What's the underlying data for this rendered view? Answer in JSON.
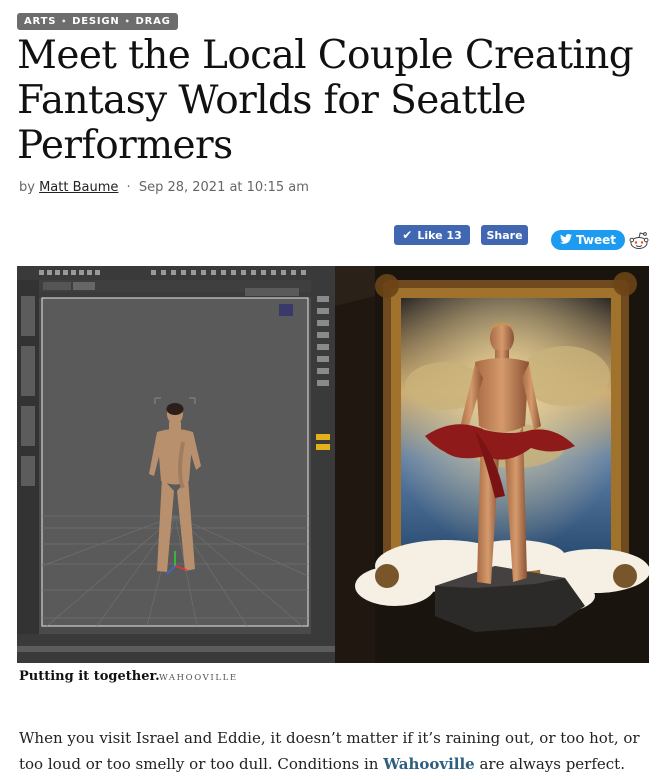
{
  "article": {
    "tags": [
      "ARTS",
      "DESIGN",
      "DRAG"
    ],
    "headline": "Meet the Local Couple Creating Fantasy Worlds for Seattle Performers",
    "byline": {
      "prefix": "by",
      "author": "Matt Baume",
      "date": "Sep 28, 2021 at 10:15 am"
    }
  },
  "social": {
    "like_label": "Like 13",
    "share_label": "Share",
    "tweet_label": "Tweet"
  },
  "figure": {
    "caption": "Putting it together.",
    "credit": "WAHOOVILLE"
  },
  "body": {
    "text_before": "When you visit Israel and Eddie, it doesn’t matter if it’s raining out, or too hot, or too loud or too smelly or too dull. Conditions in ",
    "link_text": "Wahooville",
    "text_after": " are always perfect."
  },
  "colors": {
    "facebook": "#4267b2",
    "twitter": "#1d9bf0",
    "tag_bg": "#6d6d6d",
    "link": "#2f5f7f"
  }
}
